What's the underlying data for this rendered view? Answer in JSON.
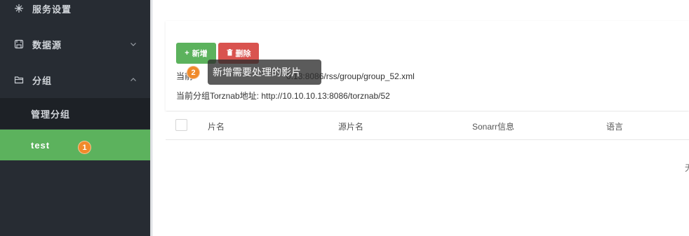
{
  "sidebar": {
    "items": [
      {
        "label": "服务设置",
        "icon": "sparkle-icon"
      },
      {
        "label": "数据源",
        "icon": "save-icon",
        "chevron": "chevron-down-icon"
      },
      {
        "label": "分组",
        "icon": "folder-icon",
        "chevron": "chevron-up-icon"
      }
    ],
    "submenu": [
      {
        "label": "管理分组"
      },
      {
        "label": "test",
        "active": true
      }
    ],
    "badge": "1"
  },
  "toolbar": {
    "add_label": "新增",
    "add_icon": "+",
    "delete_label": "删除",
    "delete_icon": "trash-icon"
  },
  "info": {
    "rss_prefix": "当前",
    "rss_suffix": "0.13:8086/rss/group/group_52.xml",
    "torznab": "当前分组Torznab地址: http://10.10.10.13:8086/torznab/52"
  },
  "tooltip": {
    "badge": "2",
    "text": "新增需要处理的影片"
  },
  "table": {
    "headers": [
      "片名",
      "源片名",
      "Sonarr信息",
      "语言"
    ],
    "empty_fragment": "无"
  },
  "colors": {
    "sidebar_bg": "#272c33",
    "active_green": "#5cb25d",
    "danger_red": "#d9534f",
    "badge_orange": "#f08a2a"
  }
}
